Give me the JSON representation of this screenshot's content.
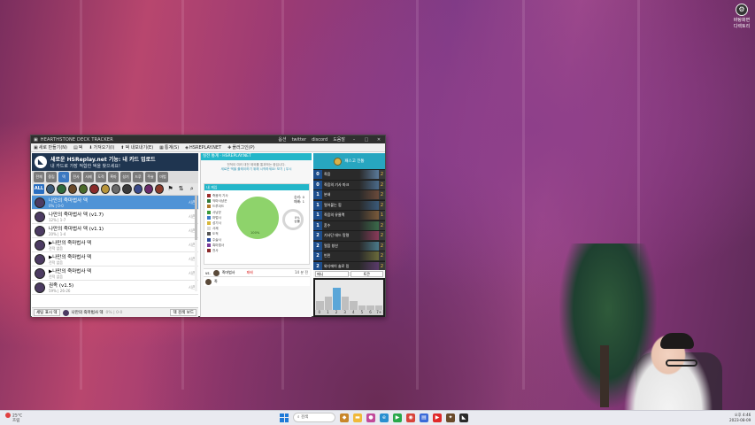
{
  "desktop": {
    "icon_label": "바탕화면 디렉토리"
  },
  "window": {
    "title": "HEARTHSTONE DECK TRACKER",
    "title_links": [
      "옵션",
      "twitter",
      "discord",
      "도움말"
    ],
    "menu": [
      {
        "icon": "doc-icon",
        "glyph": "▣",
        "label": "새로 만들기(N)"
      },
      {
        "icon": "deck-icon",
        "glyph": "▤",
        "label": "덱"
      },
      {
        "icon": "import-icon",
        "glyph": "⬇",
        "label": "가져오기(I)"
      },
      {
        "icon": "export-icon",
        "glyph": "⬆",
        "label": "덱 내보내기(E)"
      },
      {
        "icon": "stats-icon",
        "glyph": "▦",
        "label": "통계(S)"
      },
      {
        "icon": "hsreplay-icon",
        "glyph": "◈",
        "label": "HSREPLAY.NET"
      },
      {
        "icon": "plugin-icon",
        "glyph": "✚",
        "label": "플러그인(P)"
      }
    ]
  },
  "banner": {
    "line1": "새로운 HSReplay.net 기능: 내 카드 업로드",
    "line2": "내 카드로 가장 적합한 덱을 찾으세요!"
  },
  "class_filters": [
    "전체",
    "중립",
    "덱",
    "전사",
    "사제",
    "도적",
    "흑마",
    "성기",
    "드루",
    "주술",
    "마법"
  ],
  "filter_bar": {
    "all_label": "ALL"
  },
  "decks": [
    {
      "name": "나만의 죽마법사 덱",
      "sub": "0% | 0-0",
      "right": "시즌",
      "selected": true
    },
    {
      "name": "나만의 죽마법사 덱 (v1.7)",
      "sub": "12% | 1-7",
      "right": "시즌",
      "selected": false
    },
    {
      "name": "나만의 죽마법사 덱 (v1.1)",
      "sub": "20% | 1-4",
      "right": "시즌",
      "selected": false
    },
    {
      "name": "▶나만의 죽마법사 덱",
      "sub": "전적 없음",
      "right": "시즌",
      "selected": false
    },
    {
      "name": "▶나만의 죽마법사 덱",
      "sub": "전적 없음",
      "right": "시즌",
      "selected": false
    },
    {
      "name": "▶나만의 죽마법사 덱",
      "sub": "전적 없음",
      "right": "시즌",
      "selected": false
    },
    {
      "name": "권족 (v1.5)",
      "sub": "59% | 26-26",
      "right": "시즌",
      "selected": false
    }
  ],
  "bottom_bar": {
    "button1": "세팅 표시 덱",
    "current": "나만의 죽마법사 덱",
    "current_sub": "0% | 0-0",
    "button2": "덱 검색 보드"
  },
  "middle": {
    "header": "실전 통계 · HSREPLAY.NET",
    "notice1": "전적이 여러 대전 제외를 통과하는 중입니다.",
    "notice2": "세로운 덱을 플레이하기 위해 시작하세요! 보기 | 무시",
    "stats_header": "내 게임",
    "legend": [
      {
        "label": "죽음의 기사",
        "color": "#9b2c2c"
      },
      {
        "label": "악마사냥꾼",
        "color": "#2f7a3a"
      },
      {
        "label": "드루이드",
        "color": "#b07a2c"
      },
      {
        "label": "사냥꾼",
        "color": "#3a9a3a"
      },
      {
        "label": "마법사",
        "color": "#3a7ac8"
      },
      {
        "label": "성기사",
        "color": "#d7b73a"
      },
      {
        "label": "사제",
        "color": "#d8d8d8"
      },
      {
        "label": "도적",
        "color": "#555555"
      },
      {
        "label": "주술사",
        "color": "#2a4a9a"
      },
      {
        "label": "흑마법사",
        "color": "#7a3a9a"
      },
      {
        "label": "전사",
        "color": "#8a2a2a"
      }
    ],
    "pie_label": "100%",
    "win_count": "승리: 0",
    "loss_count": "패배: 1",
    "winrate": "0%",
    "winrate_label": "승률",
    "matches": [
      {
        "vs": "vs.",
        "opponent": "죽마법사",
        "result": "패배",
        "date": "14 분 전"
      },
      {
        "vs": "",
        "opponent": "죽",
        "result": "",
        "date": ""
      }
    ]
  },
  "right": {
    "header": "패스고 전통",
    "cards": [
      {
        "cost": "0",
        "name": "죽음",
        "count": "2",
        "art": "#5a7a9a"
      },
      {
        "cost": "0",
        "name": "죽음의 기사 마크",
        "count": "2",
        "art": "#4a6a8a"
      },
      {
        "cost": "1",
        "name": "분쇄",
        "count": "2",
        "art": "#6a4a3a"
      },
      {
        "cost": "1",
        "name": "얼어붙는 힘",
        "count": "2",
        "art": "#3a5a7a"
      },
      {
        "cost": "1",
        "name": "죽음의 유물맥",
        "count": "1",
        "art": "#7a5a3a"
      },
      {
        "cost": "1",
        "name": "혼수",
        "count": "2",
        "art": "#3a6a4a"
      },
      {
        "cost": "2",
        "name": "기사단 데드 망령",
        "count": "2",
        "art": "#8a3a5a"
      },
      {
        "cost": "2",
        "name": "얼음 창산",
        "count": "2",
        "art": "#4a7a8a"
      },
      {
        "cost": "2",
        "name": "빈민",
        "count": "2",
        "art": "#6a6a3a"
      },
      {
        "cost": "2",
        "name": "와디에이 솔로 밍",
        "count": "2",
        "art": "#5a3a6a"
      }
    ],
    "select_label": "매니",
    "button_label": "토큰",
    "mana_curve": [
      2,
      3,
      5,
      3,
      2,
      1,
      1,
      1
    ],
    "mana_max": 6,
    "mana_axis": [
      "0",
      "1",
      "2",
      "3",
      "4",
      "5",
      "6",
      "7+"
    ]
  },
  "taskbar": {
    "temp": "25°C",
    "weather": "흐림",
    "search_placeholder": "검색",
    "time": "오후 4:46",
    "date": "2023-08-09"
  }
}
